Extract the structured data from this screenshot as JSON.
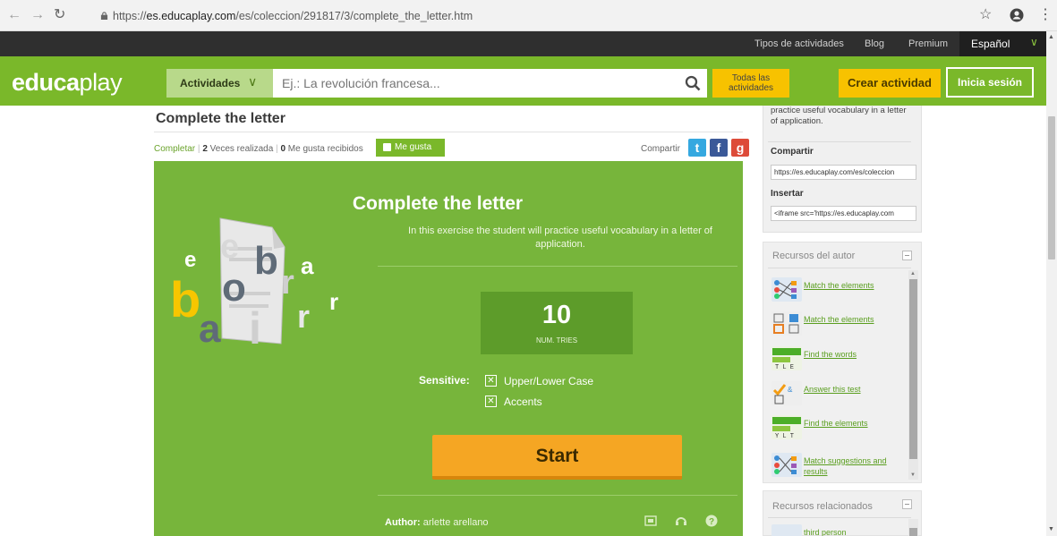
{
  "browser": {
    "url_prefix": "https://",
    "url_host": "es.educaplay.com",
    "url_path": "/es/coleccion/291817/3/complete_the_letter.htm"
  },
  "top_links": [
    "Tipos de actividades",
    "Blog",
    "Premium"
  ],
  "language": "Español",
  "header": {
    "logo_a": "educa",
    "logo_b": "play",
    "activities_label": "Actividades",
    "search_placeholder": "Ej.: La revolución francesa...",
    "all_activities": "Todas las actividades",
    "create_label": "Crear actividad",
    "login_label": "Inicia sesión"
  },
  "page": {
    "title": "Complete the letter",
    "type": "Completar",
    "times_count": "2",
    "times_label": "Veces realizada",
    "likes_count": "0",
    "likes_label": "Me gusta recibidos",
    "like_button": "Me gusta",
    "share_label": "Compartir"
  },
  "activity": {
    "title": "Complete the letter",
    "description": "In this exercise the student will practice useful vocabulary in a letter of application.",
    "tries_value": "10",
    "tries_label": "NUM. TRIES",
    "sensitive_label": "Sensitive:",
    "options": [
      "Upper/Lower Case",
      "Accents"
    ],
    "start_label": "Start",
    "author_label": "Author:",
    "author_name": "arlette arellano"
  },
  "sidebar": {
    "desc_tail": "practice useful vocabulary in a letter of application.",
    "share_heading": "Compartir",
    "share_url": "https://es.educaplay.com/es/coleccion",
    "embed_heading": "Insertar",
    "embed_code": "<iframe src='https://es.educaplay.com",
    "author_resources_heading": "Recursos del autor",
    "resources": [
      "Match the elements",
      "Match the elements",
      "Find the words",
      "Answer this test",
      "Find the elements",
      "Match suggestions and results"
    ],
    "related_heading": "Recursos relacionados",
    "related_first": "third person"
  },
  "colors": {
    "brand_green": "#7ab82a",
    "activity_green": "#77b53b",
    "accent_yellow": "#f7c200",
    "start_orange": "#f5a623"
  }
}
